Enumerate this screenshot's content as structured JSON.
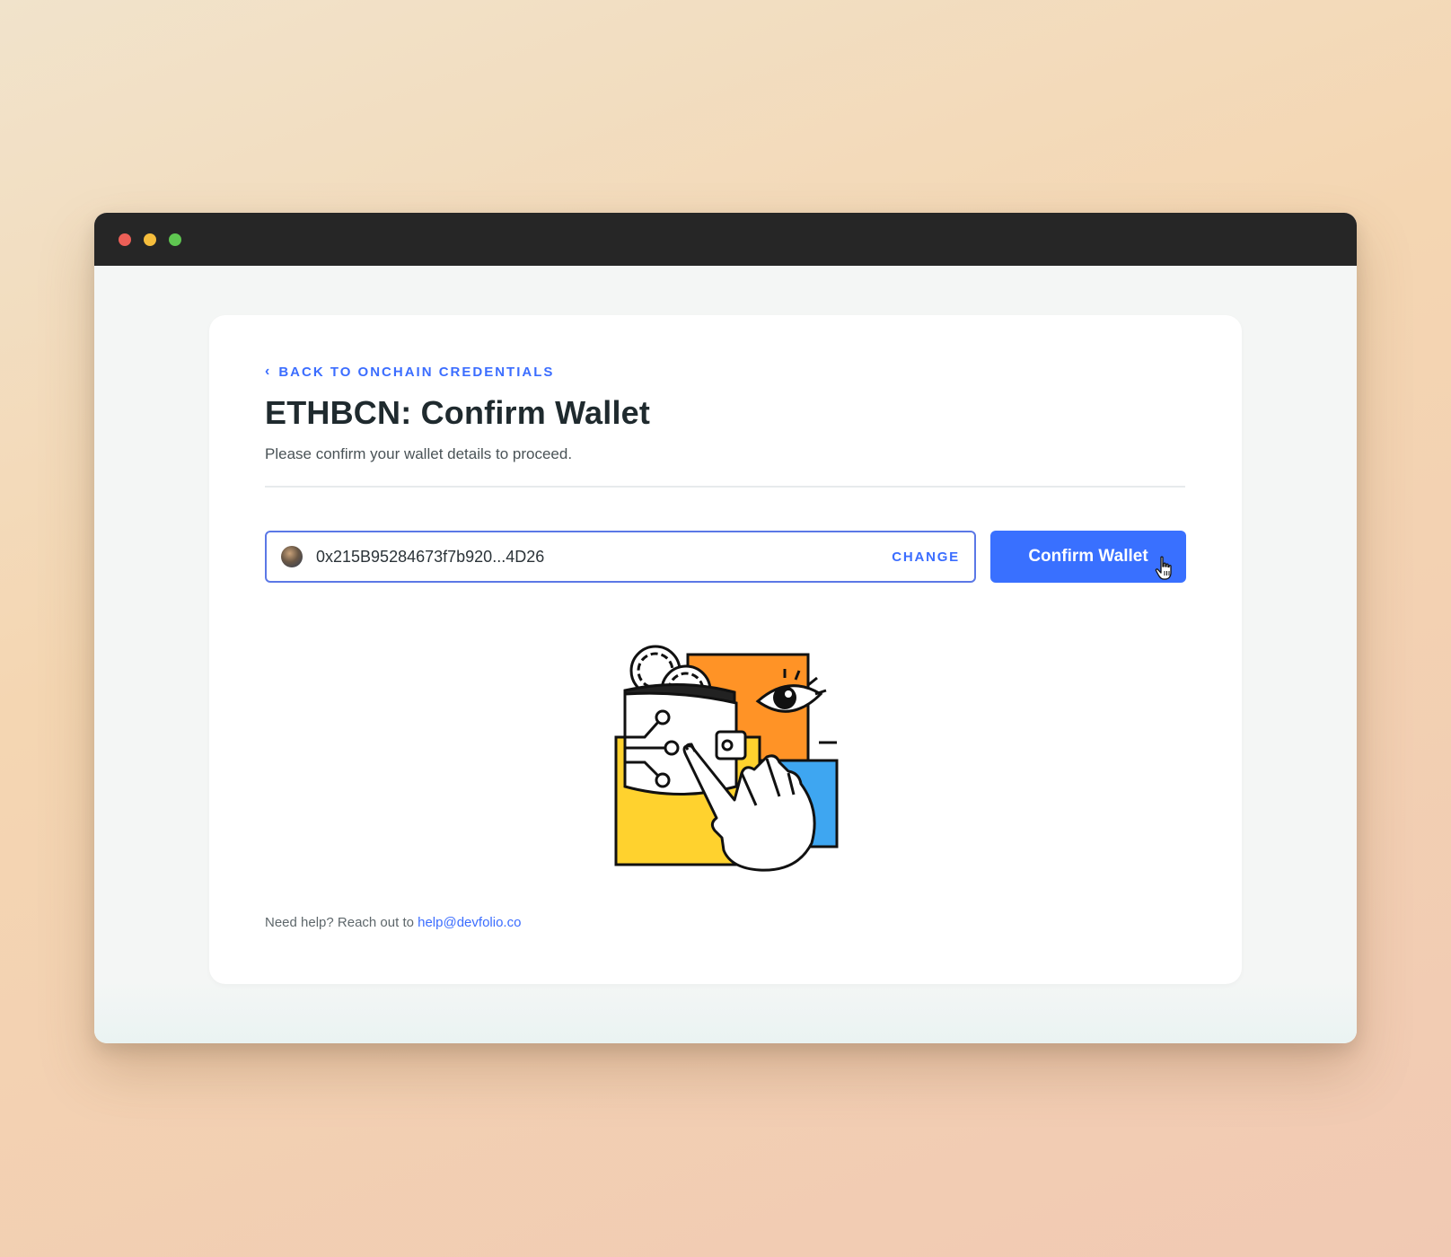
{
  "window": {
    "controls": [
      "close",
      "minimize",
      "maximize"
    ]
  },
  "card": {
    "back_link": "BACK TO ONCHAIN CREDENTIALS",
    "back_icon": "chevron-left-icon",
    "title": "ETHBCN: Confirm Wallet",
    "subtitle": "Please confirm your wallet details to proceed.",
    "wallet": {
      "address": "0x215B95284673f7b920...4D26",
      "change_label": "CHANGE"
    },
    "confirm_label": "Confirm Wallet",
    "help": {
      "text": "Need help? Reach out to ",
      "email": "help@devfolio.co"
    }
  },
  "colors": {
    "accent": "#3970ff",
    "title": "#1f2a2e",
    "titlebar": "#262626"
  }
}
